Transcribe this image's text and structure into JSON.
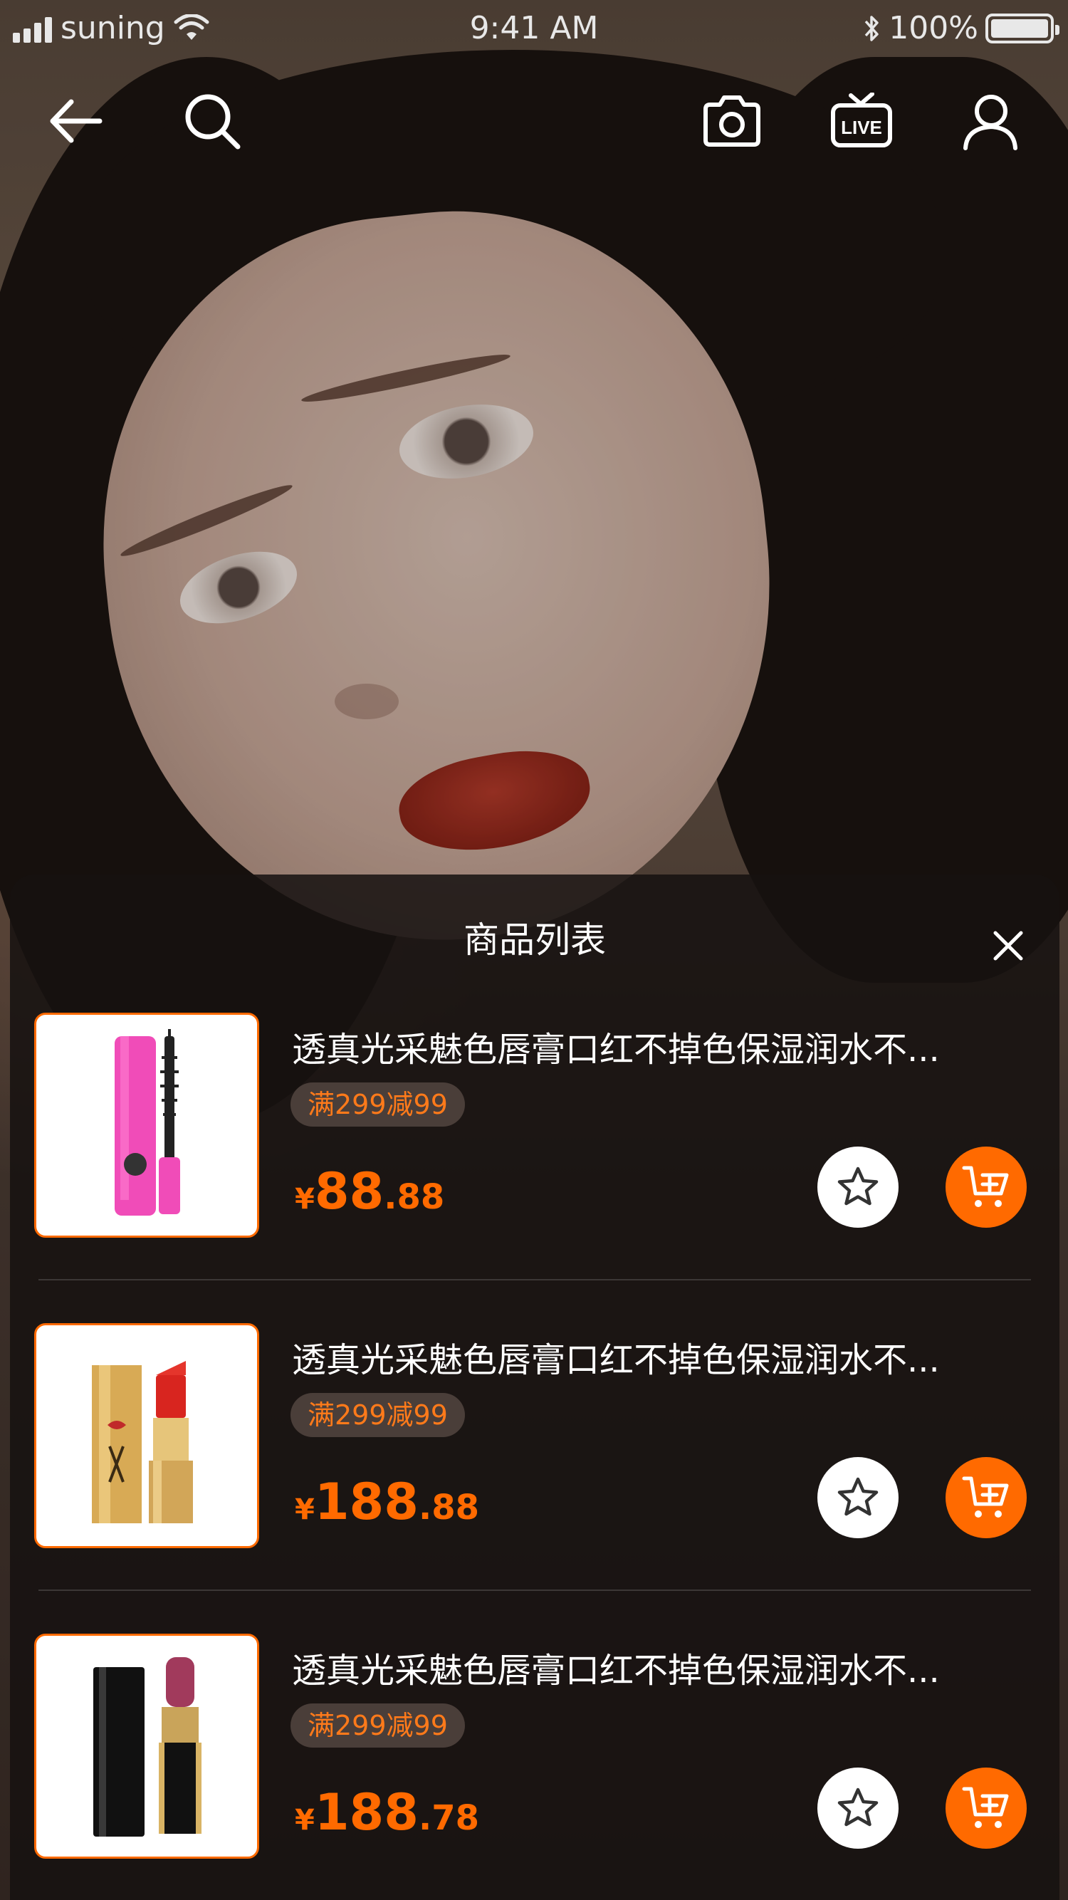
{
  "status_bar": {
    "carrier": "suning",
    "time": "9:41 AM",
    "battery": "100%",
    "battery_level": 1.0
  },
  "nav": {
    "icons": [
      "back-arrow-icon",
      "search-icon",
      "camera-icon",
      "live-tv-icon",
      "user-icon"
    ],
    "live_badge": "LIVE"
  },
  "panel": {
    "title": "商品列表",
    "close_icon": "close-icon",
    "items": [
      {
        "name": "透真光采魅色唇膏口红不掉色保湿润水不...",
        "tag": "满299减99",
        "currency": "¥",
        "price_int": "88",
        "price_dec": ".88",
        "image": "mascara"
      },
      {
        "name": "透真光采魅色唇膏口红不掉色保湿润水不...",
        "tag": "满299减99",
        "currency": "¥",
        "price_int": "188",
        "price_dec": ".88",
        "image": "gold-lipstick"
      },
      {
        "name": "透真光采魅色唇膏口红不掉色保湿润水不...",
        "tag": "满299减99",
        "currency": "¥",
        "price_int": "188",
        "price_dec": ".78",
        "image": "black-lipstick"
      }
    ]
  },
  "colors": {
    "accent": "#ff6a00",
    "tag_bg": "#4a3e39",
    "panel_bg": "#161210"
  }
}
